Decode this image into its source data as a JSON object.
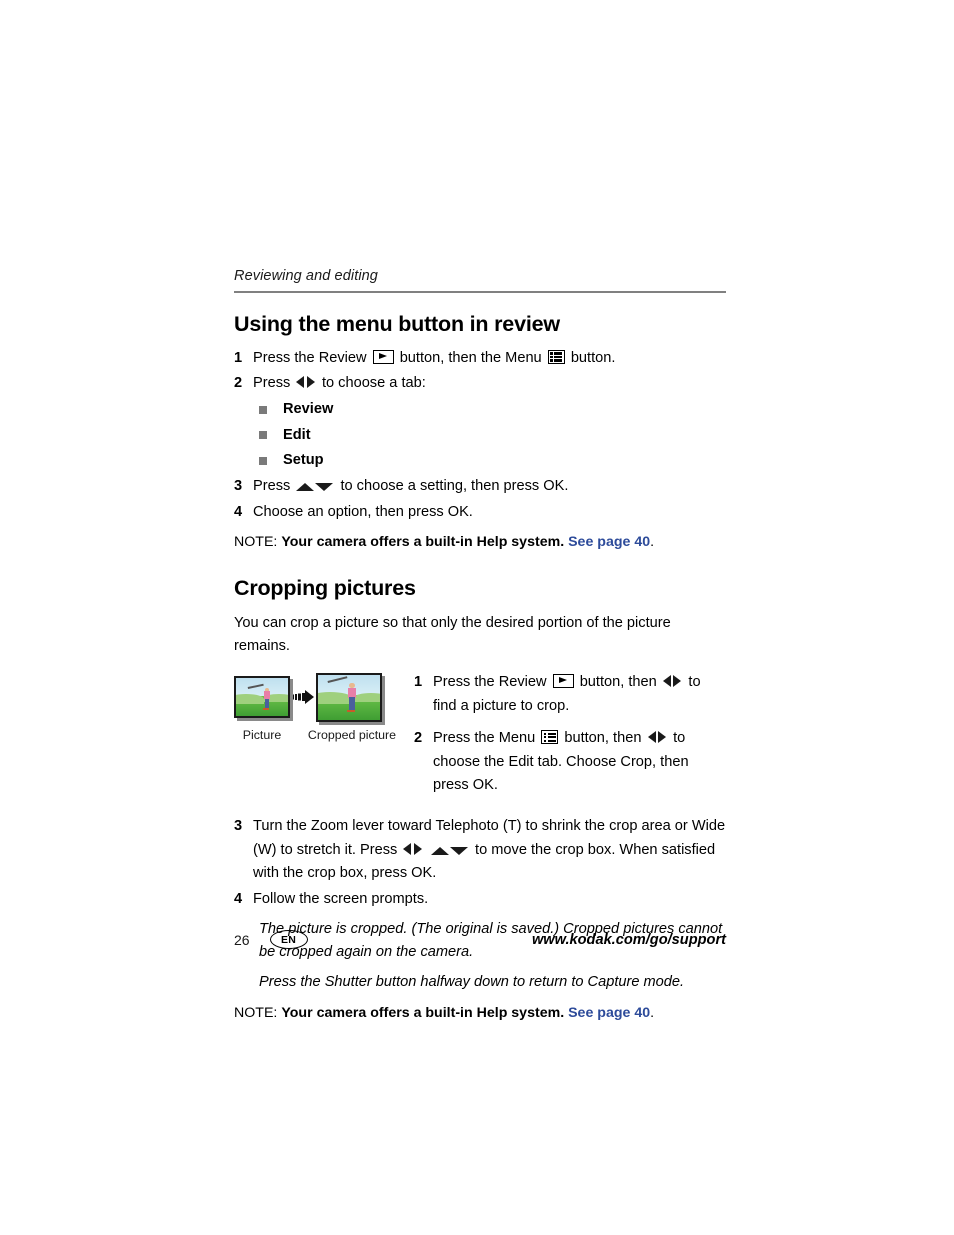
{
  "header": {
    "running_head": "Reviewing and editing"
  },
  "sections": [
    {
      "title": "Using the menu button in review",
      "steps": [
        {
          "num": "1",
          "pre": "Press the Review",
          "mid": "button, then the Menu",
          "post": "button."
        },
        {
          "num": "2",
          "pre": "Press",
          "post": "to choose a tab:"
        },
        {
          "num": "3",
          "pre": "Press",
          "post": "to choose a setting, then press OK."
        },
        {
          "num": "4",
          "text": "Choose an option, then press OK."
        }
      ],
      "tabs": [
        {
          "label": "Review"
        },
        {
          "label": "Edit"
        },
        {
          "label": "Setup"
        }
      ],
      "note": {
        "label": "NOTE:",
        "text": "Your camera offers a built-in Help system.",
        "link": "See page 40",
        "period": "."
      }
    },
    {
      "title": "Cropping pictures",
      "intro": "You can crop a picture so that only the desired portion of the picture remains.",
      "figure": {
        "caption_before": "Picture",
        "caption_after": "Cropped picture",
        "arrow": "right-arrow-icon"
      },
      "figure_steps": [
        {
          "num": "1",
          "pre": "Press the Review",
          "mid": "button, then",
          "post": "to find a picture to crop."
        },
        {
          "num": "2",
          "pre": "Press the Menu",
          "mid": "button, then",
          "post": "to choose the Edit tab. Choose Crop, then press OK."
        }
      ],
      "steps": [
        {
          "num": "3",
          "pre": "Turn the Zoom lever toward Telephoto (T) to shrink the crop area or Wide (W) to stretch it. Press",
          "post": "to move the crop box. When satisfied with the crop box, press OK."
        },
        {
          "num": "4",
          "text": "Follow the screen prompts."
        }
      ],
      "italics": [
        "The picture is cropped. (The original is saved.) Cropped pictures cannot be cropped again on the camera.",
        "Press the Shutter button halfway down to return to Capture mode."
      ],
      "note": {
        "label": "NOTE:",
        "text": "Your camera offers a built-in Help system.",
        "link": "See page 40",
        "period": "."
      }
    }
  ],
  "footer": {
    "page_number": "26",
    "language_badge": "EN",
    "url": "www.kodak.com/go/support"
  },
  "colors": {
    "rule": "#808080",
    "bullet": "#7a7a7a",
    "link": "#2d4b9a",
    "text": "#000000"
  }
}
